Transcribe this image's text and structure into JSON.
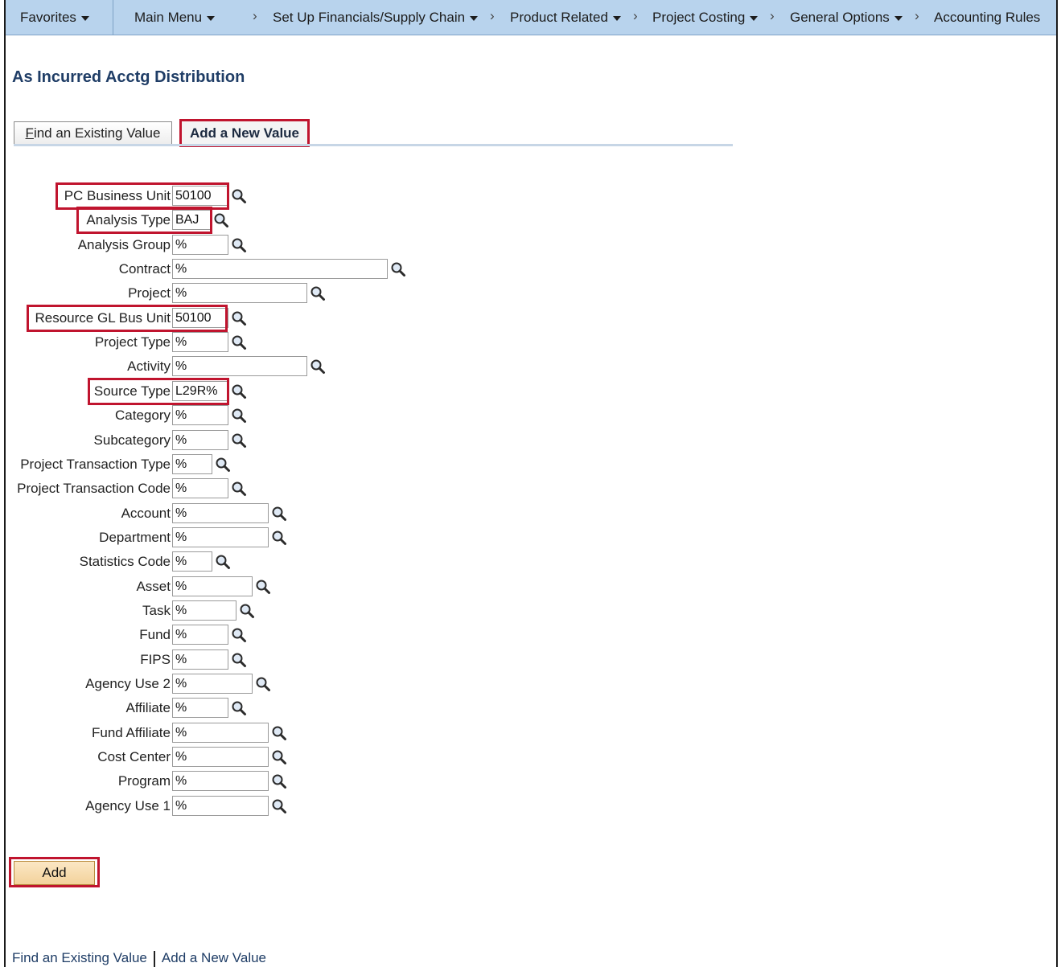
{
  "nav": {
    "favorites": "Favorites",
    "main_menu": "Main Menu",
    "crumbs": [
      "Set Up Financials/Supply Chain",
      "Product Related",
      "Project Costing",
      "General Options",
      "Accounting Rules"
    ]
  },
  "page": {
    "title": "As Incurred Acctg Distribution"
  },
  "tabs": {
    "find_prefix": "F",
    "find_rest": "ind an Existing Value",
    "add": "Add a New Value"
  },
  "fields": [
    {
      "label": "PC Business Unit",
      "value": "50100"
    },
    {
      "label": "Analysis Type",
      "value": "BAJ"
    },
    {
      "label": "Analysis Group",
      "value": "%"
    },
    {
      "label": "Contract",
      "value": "%"
    },
    {
      "label": "Project",
      "value": "%"
    },
    {
      "label": "Resource GL Bus Unit",
      "value": "50100"
    },
    {
      "label": "Project Type",
      "value": "%"
    },
    {
      "label": "Activity",
      "value": "%"
    },
    {
      "label": "Source Type",
      "value": "L29R%"
    },
    {
      "label": "Category",
      "value": "%"
    },
    {
      "label": "Subcategory",
      "value": "%"
    },
    {
      "label": "Project Transaction Type",
      "value": "%"
    },
    {
      "label": "Project Transaction Code",
      "value": "%"
    },
    {
      "label": "Account",
      "value": "%"
    },
    {
      "label": "Department",
      "value": "%"
    },
    {
      "label": "Statistics Code",
      "value": "%"
    },
    {
      "label": "Asset",
      "value": "%"
    },
    {
      "label": "Task",
      "value": "%"
    },
    {
      "label": "Fund",
      "value": "%"
    },
    {
      "label": "FIPS",
      "value": "%"
    },
    {
      "label": "Agency Use 2",
      "value": "%"
    },
    {
      "label": "Affiliate",
      "value": "%"
    },
    {
      "label": "Fund Affiliate",
      "value": "%"
    },
    {
      "label": "Cost Center",
      "value": "%"
    },
    {
      "label": "Program",
      "value": "%"
    },
    {
      "label": "Agency Use 1",
      "value": "%"
    }
  ],
  "actions": {
    "add": "Add"
  },
  "footer": {
    "find": "Find an Existing Value",
    "add": "Add a New Value"
  },
  "colors": {
    "highlight": "#c0142e",
    "navbar": "#b8d3ed",
    "title": "#1f3d66"
  }
}
